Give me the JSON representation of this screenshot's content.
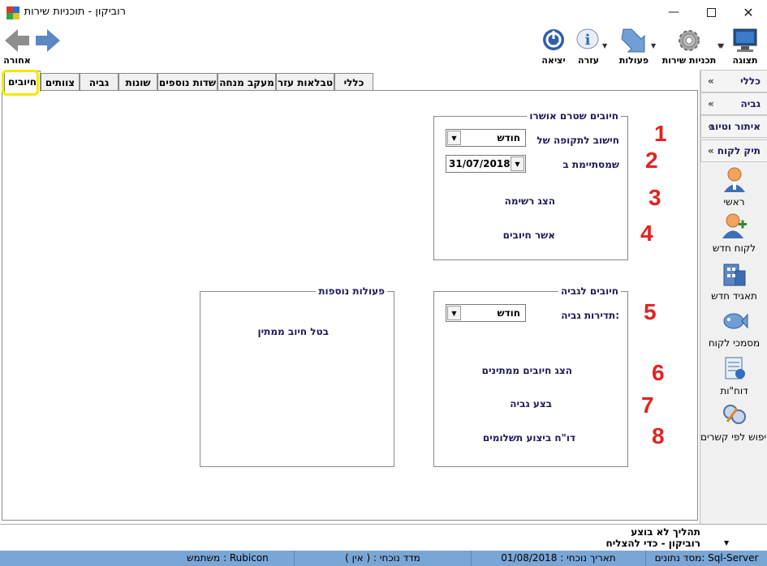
{
  "window": {
    "title": "רוביקון  -  תוכניות שירות",
    "controls": [
      "minimize",
      "maximize",
      "close"
    ]
  },
  "toolbar": {
    "left": [
      {
        "name": "back",
        "label": "אחורה"
      },
      {
        "name": "forward",
        "label": "קדימה"
      }
    ],
    "right": [
      {
        "name": "exit",
        "label": "יציאה",
        "icon": "power-icon"
      },
      {
        "name": "help",
        "label": "עזרה",
        "icon": "info-icon"
      },
      {
        "name": "actions",
        "label": "פעולות",
        "icon": "arrow-down-icon"
      },
      {
        "name": "service-plans",
        "label": "תכניות שירות",
        "icon": "gear-icon"
      },
      {
        "name": "display",
        "label": "תצוגה",
        "icon": "monitor-icon"
      }
    ]
  },
  "tabs": [
    {
      "label": "חיובים",
      "active": true
    },
    {
      "label": "צוותים"
    },
    {
      "label": "גביה"
    },
    {
      "label": "שונות"
    },
    {
      "label": "שדות נוספים"
    },
    {
      "label": "מעקב מנחה"
    },
    {
      "label": "טבלאות עזר"
    },
    {
      "label": "כללי"
    }
  ],
  "charges_group": {
    "title": "חיובים שטרם אושרו",
    "calc_period_label": "חישוב לתקופה של",
    "calc_period_value": "חודש",
    "ending_label": "שמסתיימת ב",
    "ending_value": "31/07/2018",
    "show_list": "הצג רשימה",
    "approve_charges": "אשר חיובים"
  },
  "collection_group": {
    "title": "חיובים לגביה",
    "frequency_label": "תדירות גביה:",
    "frequency_value": "חודש",
    "show_pending": "הצג חיובים ממתינים",
    "run_collection": "בצע גביה",
    "payment_report": "דו\"ח ביצוע תשלומים"
  },
  "extra_group": {
    "title": "פעולות נוספות",
    "cancel_pending": "בטל חיוב ממתין"
  },
  "annotations": [
    "1",
    "2",
    "3",
    "4",
    "5",
    "6",
    "7",
    "8"
  ],
  "sidebar": {
    "headers": [
      {
        "label": "כללי"
      },
      {
        "label": "גביה"
      },
      {
        "label": "איתור וטיוב"
      },
      {
        "label": "תיק לקוח"
      }
    ],
    "items": [
      {
        "label": "ראשי",
        "icon": "person-icon"
      },
      {
        "label": "לקוח חדש",
        "icon": "add-person-icon"
      },
      {
        "label": "תאגיד חדש",
        "icon": "building-icon"
      },
      {
        "label": "מסמכי לקוח",
        "icon": "fish-icon"
      },
      {
        "label": "דוח\"ות",
        "icon": "report-icon"
      },
      {
        "label": "חיפוש לפי קשרים",
        "icon": "link-search-icon"
      }
    ]
  },
  "messages": {
    "line1": "תהליך לא בוצע",
    "line2": "רוביקון - כדי להצליח"
  },
  "status": {
    "db": "מסד נתונים: Sql-Server",
    "date": "תאריך נוכחי : 01/08/2018",
    "index": "מדד נוכחי : ( אין )",
    "user": "משתמש : Rubicon"
  },
  "colors": {
    "label": "#1c1c5c",
    "annotation": "#e32222",
    "highlight": "#f5e800",
    "statusbar": "#7aa6d6"
  }
}
